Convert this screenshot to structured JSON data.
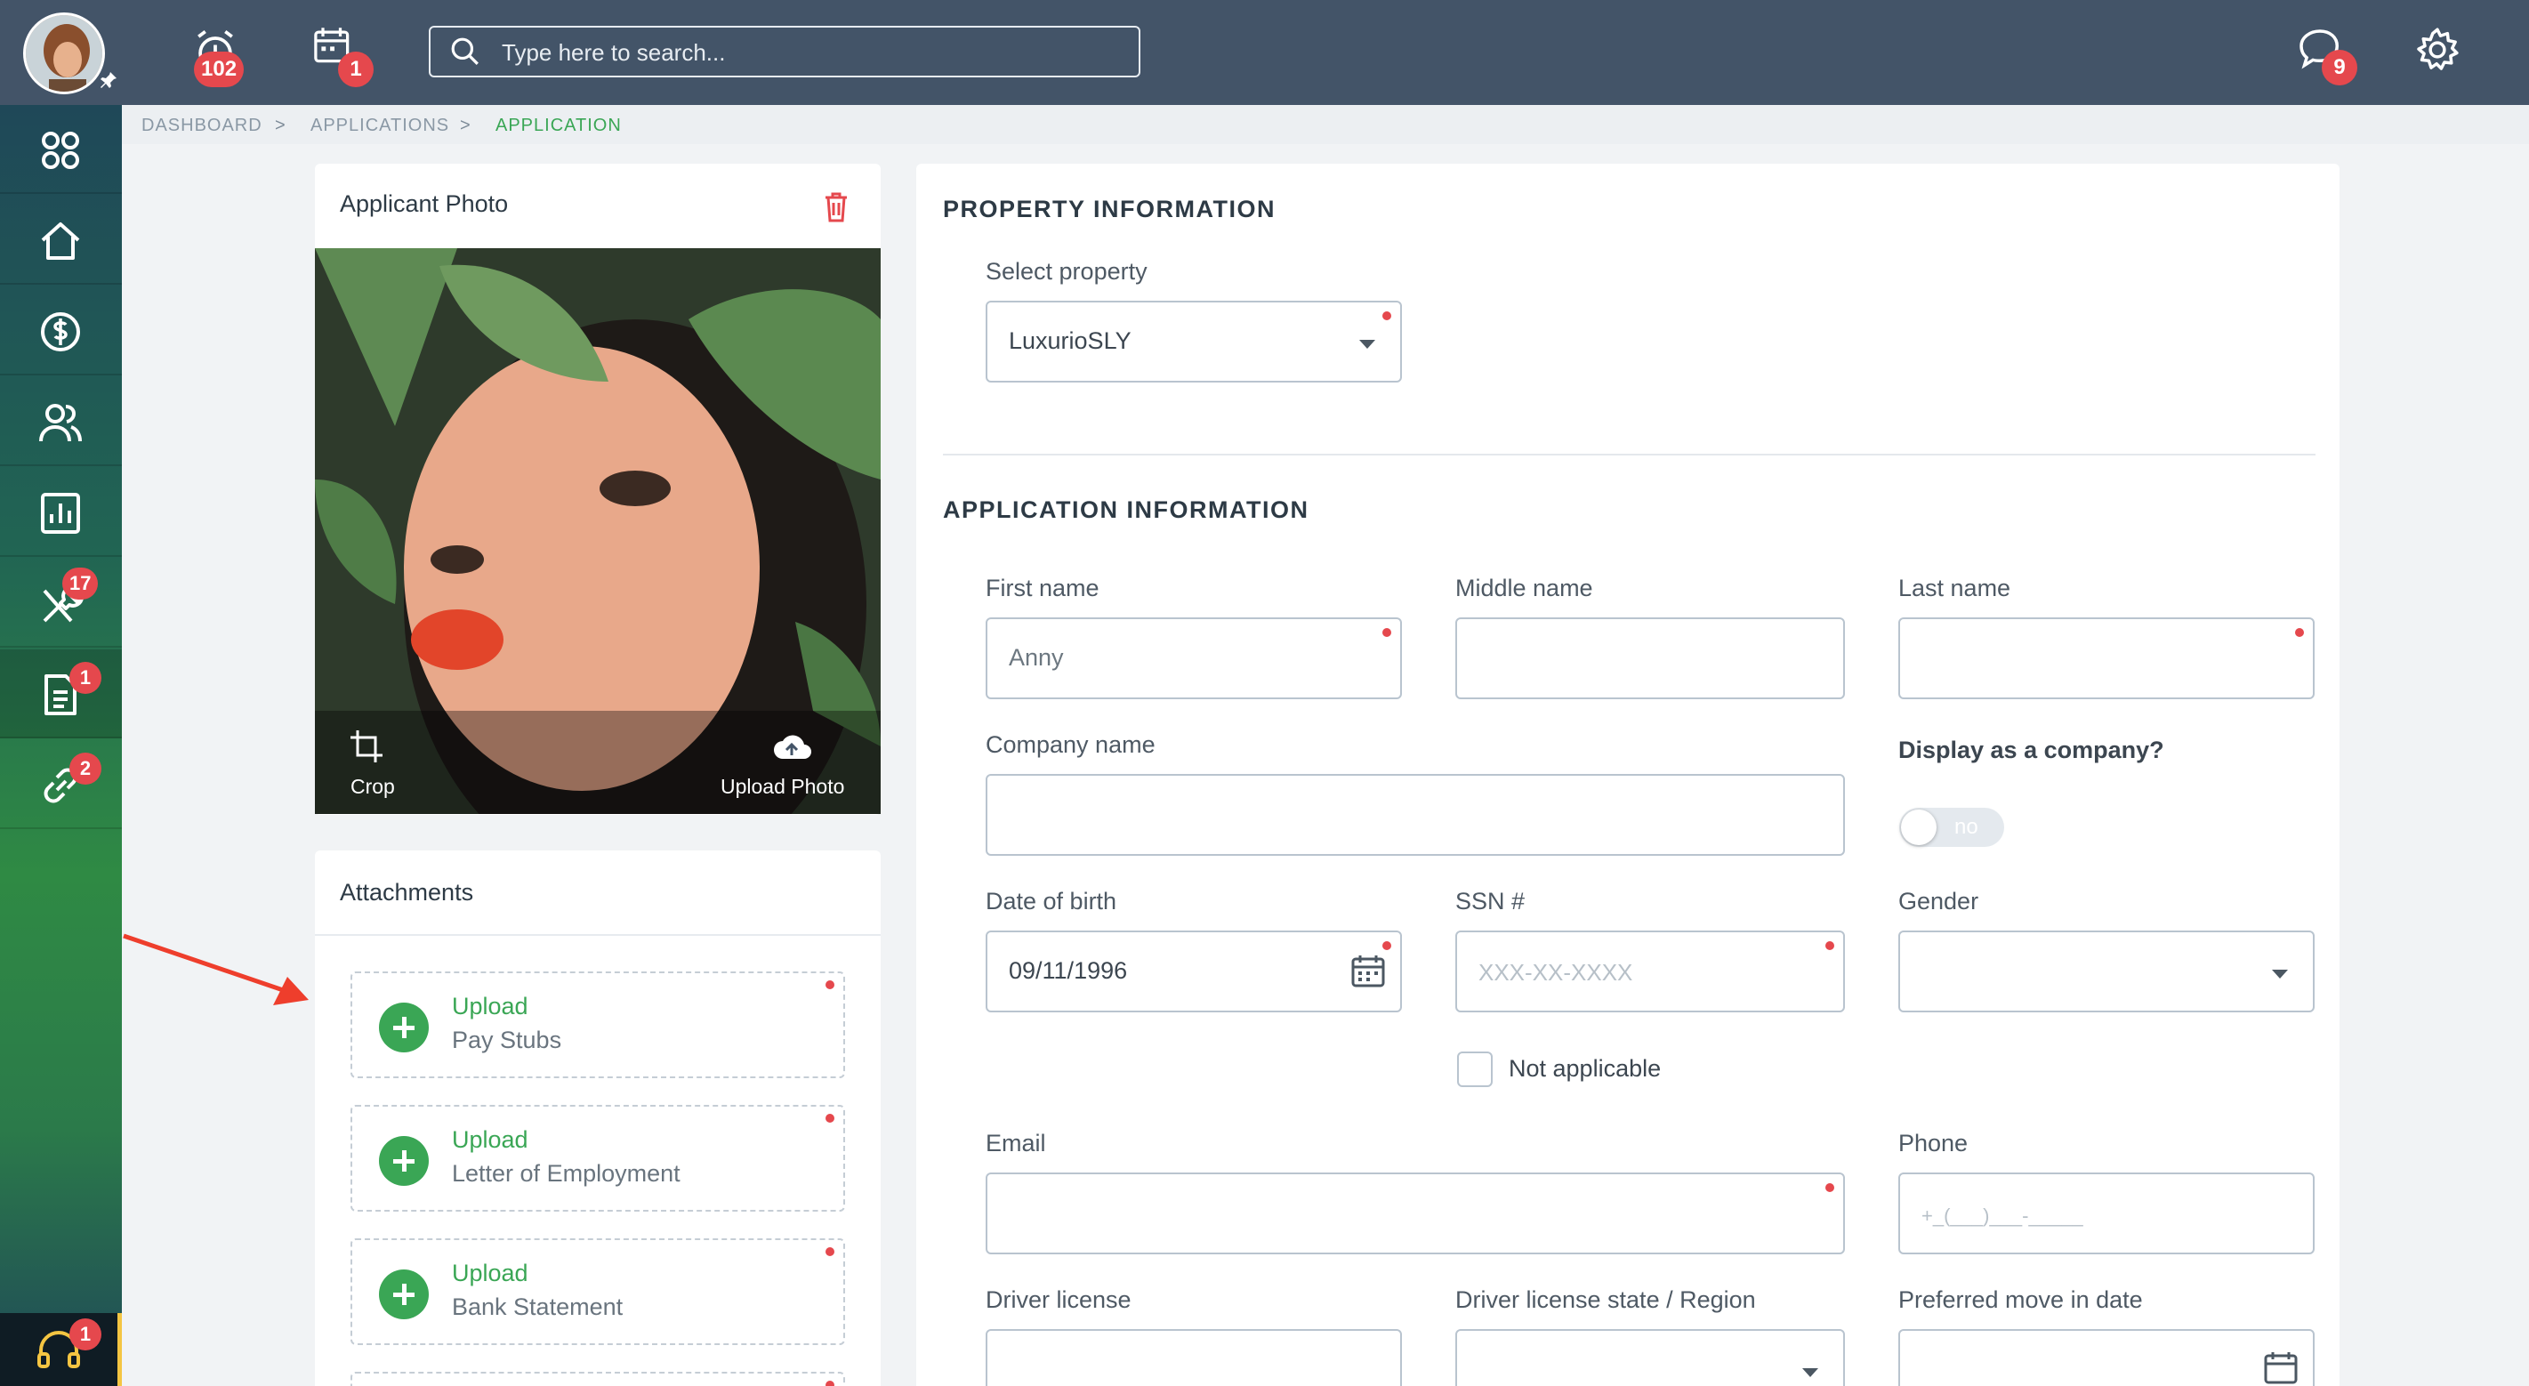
{
  "colors": {
    "topbar": "#435468",
    "accent_green": "#3aa655",
    "badge_red": "#e5484d",
    "warning": "#f4c542"
  },
  "topbar": {
    "alarm_count": "102",
    "calendar_count": "1",
    "search_placeholder": "Type here to search...",
    "messages_count": "9",
    "icons": [
      "alarm-clock-icon",
      "calendar-icon",
      "search-icon",
      "chat-bubble-icon",
      "gear-icon"
    ]
  },
  "sidebar": {
    "items": [
      {
        "name": "apps",
        "icon": "grid-icon"
      },
      {
        "name": "home",
        "icon": "home-icon"
      },
      {
        "name": "payments",
        "icon": "dollar-icon"
      },
      {
        "name": "people",
        "icon": "users-icon"
      },
      {
        "name": "reports",
        "icon": "chart-icon"
      },
      {
        "name": "maintenance",
        "icon": "tools-icon",
        "badge": "17"
      },
      {
        "name": "applications",
        "icon": "document-icon",
        "badge": "1"
      },
      {
        "name": "links",
        "icon": "link-icon",
        "badge": "2"
      }
    ],
    "support_badge": "1"
  },
  "breadcrumb": {
    "items": [
      "DASHBOARD",
      "APPLICATIONS",
      "APPLICATION"
    ]
  },
  "photo_card": {
    "title": "Applicant Photo",
    "crop_label": "Crop",
    "upload_label": "Upload Photo"
  },
  "attachments": {
    "title": "Attachments",
    "items": [
      {
        "action": "Upload",
        "document": "Pay Stubs"
      },
      {
        "action": "Upload",
        "document": "Letter of Employment"
      },
      {
        "action": "Upload",
        "document": "Bank Statement"
      }
    ]
  },
  "property": {
    "section_title": "PROPERTY INFORMATION",
    "select_label": "Select property",
    "selected": "LuxurioSLY"
  },
  "application": {
    "section_title": "APPLICATION INFORMATION",
    "first_name_label": "First name",
    "first_name_value": "Anny",
    "middle_name_label": "Middle name",
    "last_name_label": "Last name",
    "company_label": "Company name",
    "display_company_label": "Display as a company?",
    "display_company_value": "no",
    "dob_label": "Date of birth",
    "dob_value": "09/11/1996",
    "ssn_label": "SSN #",
    "ssn_placeholder": "XXX-XX-XXXX",
    "gender_label": "Gender",
    "not_applicable_label": "Not applicable",
    "email_label": "Email",
    "phone_label": "Phone",
    "phone_placeholder": "+_(___)___-_____",
    "license_label": "Driver license",
    "license_state_label": "Driver license state / Region",
    "move_in_label": "Preferred move in date"
  }
}
